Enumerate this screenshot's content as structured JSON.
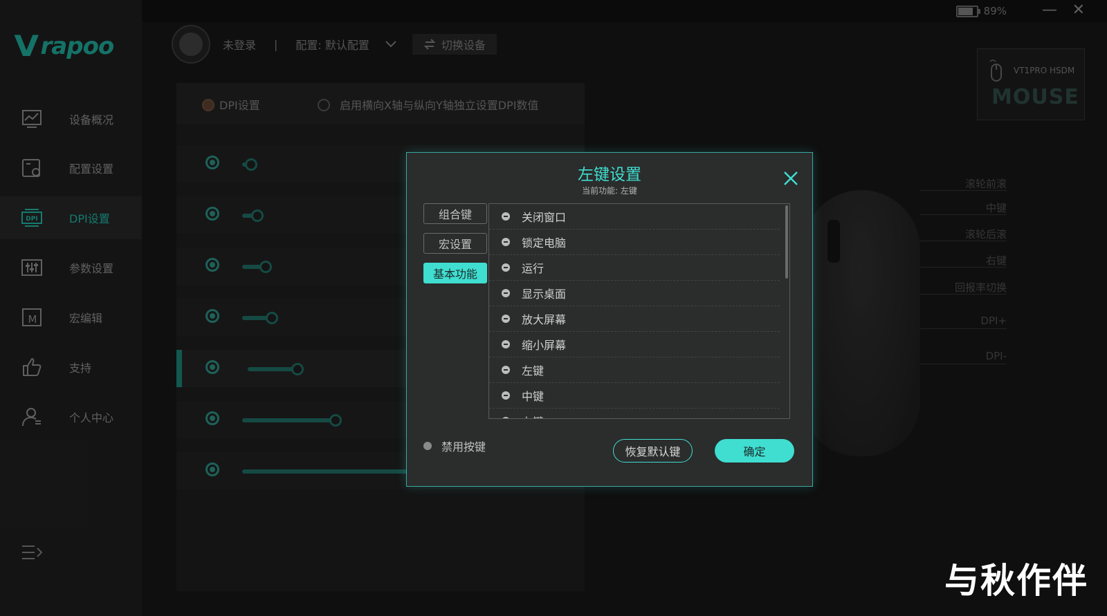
{
  "titlebar": {
    "battery": "89%",
    "battery_level": 0.89
  },
  "brand": {
    "mark": "V",
    "name": "rapoo"
  },
  "sidebar": {
    "items": [
      {
        "label": "设备概况",
        "icon": "chart-monitor-icon"
      },
      {
        "label": "配置设置",
        "icon": "config-icon"
      },
      {
        "label": "DPI设置",
        "icon": "dpi-icon"
      },
      {
        "label": "参数设置",
        "icon": "sliders-icon"
      },
      {
        "label": "宏编辑",
        "icon": "macro-icon"
      },
      {
        "label": "支持",
        "icon": "thumbs-up-icon"
      },
      {
        "label": "个人中心",
        "icon": "user-icon"
      }
    ],
    "active_index": 2
  },
  "header": {
    "user": "未登录",
    "separator": "|",
    "profile": "配置: 默认配置",
    "switch_device": "切换设备"
  },
  "dpi": {
    "tab_label": "DPI设置",
    "xy_option": "启用横向X轴与纵向Y轴独立设置DPI数值",
    "levels": [
      0.02,
      0.04,
      0.07,
      0.09,
      0.16,
      0.31,
      0.88
    ],
    "active_level": 4
  },
  "device": {
    "name": "VT1PRO HSDM",
    "type": "MOUSE"
  },
  "mouse_buttons": [
    "滚轮前滚",
    "中键",
    "滚轮后滚",
    "右键",
    "回报率切换",
    "DPI+",
    "DPI-"
  ],
  "modal": {
    "title": "左键设置",
    "subtitle": "当前功能: 左键",
    "tabs": [
      "组合键",
      "宏设置",
      "基本功能"
    ],
    "active_tab": 2,
    "functions": [
      "关闭窗口",
      "锁定电脑",
      "运行",
      "显示桌面",
      "放大屏幕",
      "缩小屏幕",
      "左键",
      "中键",
      "右键"
    ],
    "disable_label": "禁用按键",
    "restore_label": "恢复默认键",
    "ok_label": "确定"
  },
  "watermark": "与秋作伴",
  "colors": {
    "accent": "#3fded0",
    "accent_dark": "#1db09f",
    "bg": "#161616"
  }
}
